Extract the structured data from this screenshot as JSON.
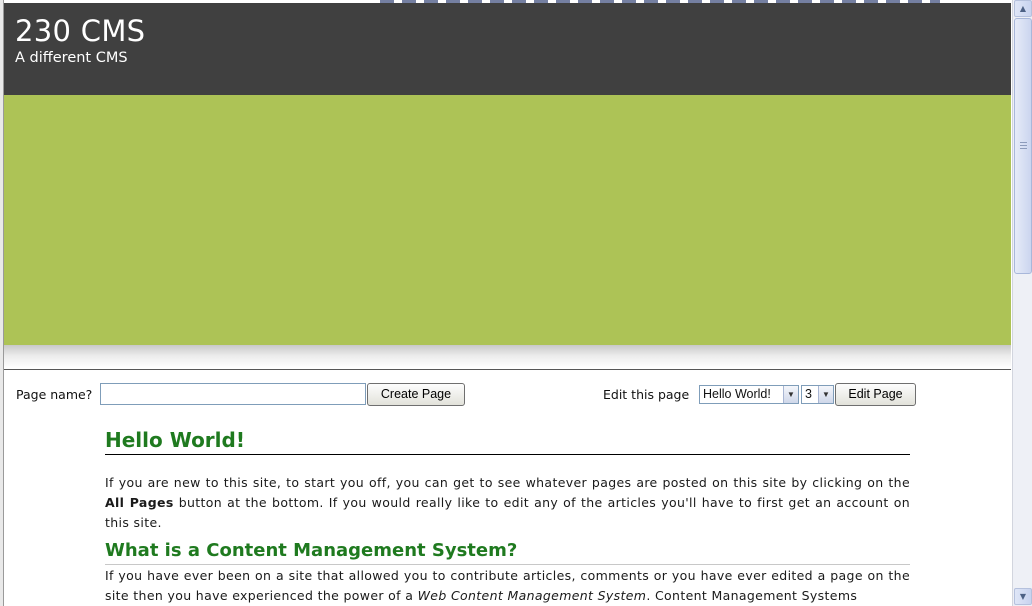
{
  "site": {
    "title": "230 CMS",
    "subtitle": "A different CMS"
  },
  "toolbar": {
    "page_name_label": "Page name?",
    "page_name_value": "",
    "create_button": "Create Page",
    "edit_label": "Edit this page",
    "page_select_value": "Hello World!",
    "revision_select_value": "3",
    "edit_button": "Edit Page"
  },
  "article": {
    "heading": "Hello World!",
    "intro_part1": "If you are new to this site, to start you off, you can get to see whatever pages are posted on this site by clicking on the ",
    "intro_bold": "All Pages",
    "intro_part2": " button at the bottom. If you would really like to edit any of the articles you'll have to first get an account on this site.",
    "section_heading": "What is a Content Management System?",
    "section_part1": "If you have ever been on a site that allowed you to contribute articles, comments or you have ever edited a page on the site then you have experienced the power of a ",
    "section_italic": "Web Content Management System",
    "section_part2": ". Content Management Systems"
  },
  "colors": {
    "header_bg": "#404040",
    "banner_bg": "#adc356",
    "heading_green": "#1f7a1f"
  },
  "icons": {
    "scroll_up": "up-arrow-icon",
    "scroll_down": "down-arrow-icon",
    "select_arrow": "chevron-down-icon"
  }
}
